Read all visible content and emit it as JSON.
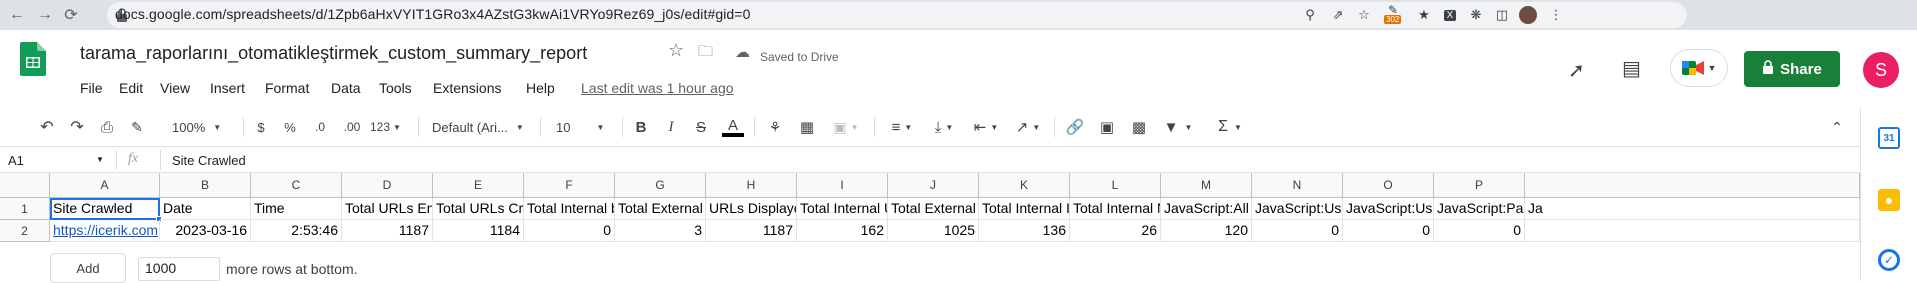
{
  "browser": {
    "url": "docs.google.com/spreadsheets/d/1Zpb6aHxVYIT1GRo3x4AZstG3kwAi1VRYo9Rez69_j0s/edit#gid=0",
    "ext_badge": "302"
  },
  "doc": {
    "title": "tarama_raporlarını_otomatikleştirmek_custom_summary_report",
    "saved_status": "Saved to Drive",
    "last_edit": "Last edit was 1 hour ago",
    "share_label": "Share",
    "avatar_letter": "S"
  },
  "menu": [
    "File",
    "Edit",
    "View",
    "Insert",
    "Format",
    "Data",
    "Tools",
    "Extensions",
    "Help"
  ],
  "toolbar": {
    "zoom": "100%",
    "currency": "$",
    "percent": "%",
    "dec_decrease": ".0",
    "dec_increase": ".00",
    "more_formats": "123",
    "font": "Default (Ari...",
    "font_size": "10",
    "bold": "B",
    "italic": "I",
    "strike": "S",
    "text_color": "A"
  },
  "formula_bar": {
    "name_box": "A1",
    "fx": "fx",
    "content": "Site Crawled"
  },
  "grid": {
    "columns": [
      "A",
      "B",
      "C",
      "D",
      "E",
      "F",
      "G",
      "H",
      "I",
      "J",
      "K",
      "L",
      "M",
      "N",
      "O",
      "P"
    ],
    "header_row": [
      "Site Crawled",
      "Date",
      "Time",
      "Total URLs Enco",
      "Total URLs Craw",
      "Total Internal blo",
      "Total External blo",
      "URLs Displayed",
      "Total Internal UR",
      "Total External UR",
      "Total Internal Ind",
      "Total Internal No",
      "JavaScript:All",
      "JavaScript:Uses",
      "JavaScript:Uses",
      "JavaScript:Page",
      "Ja"
    ],
    "data_row": [
      "https://icerik.com",
      "2023-03-16",
      "2:53:46",
      "1187",
      "1184",
      "0",
      "3",
      "1187",
      "162",
      "1025",
      "136",
      "26",
      "120",
      "0",
      "0",
      "0"
    ],
    "add_label": "Add",
    "add_rows_value": "1000",
    "add_suffix": "more rows at bottom."
  },
  "colors": {
    "share_green": "#188038",
    "avatar_pink": "#e91e63",
    "link_blue": "#1155cc",
    "selection_blue": "#1a73e8",
    "sheets_green": "#0f9d58"
  }
}
